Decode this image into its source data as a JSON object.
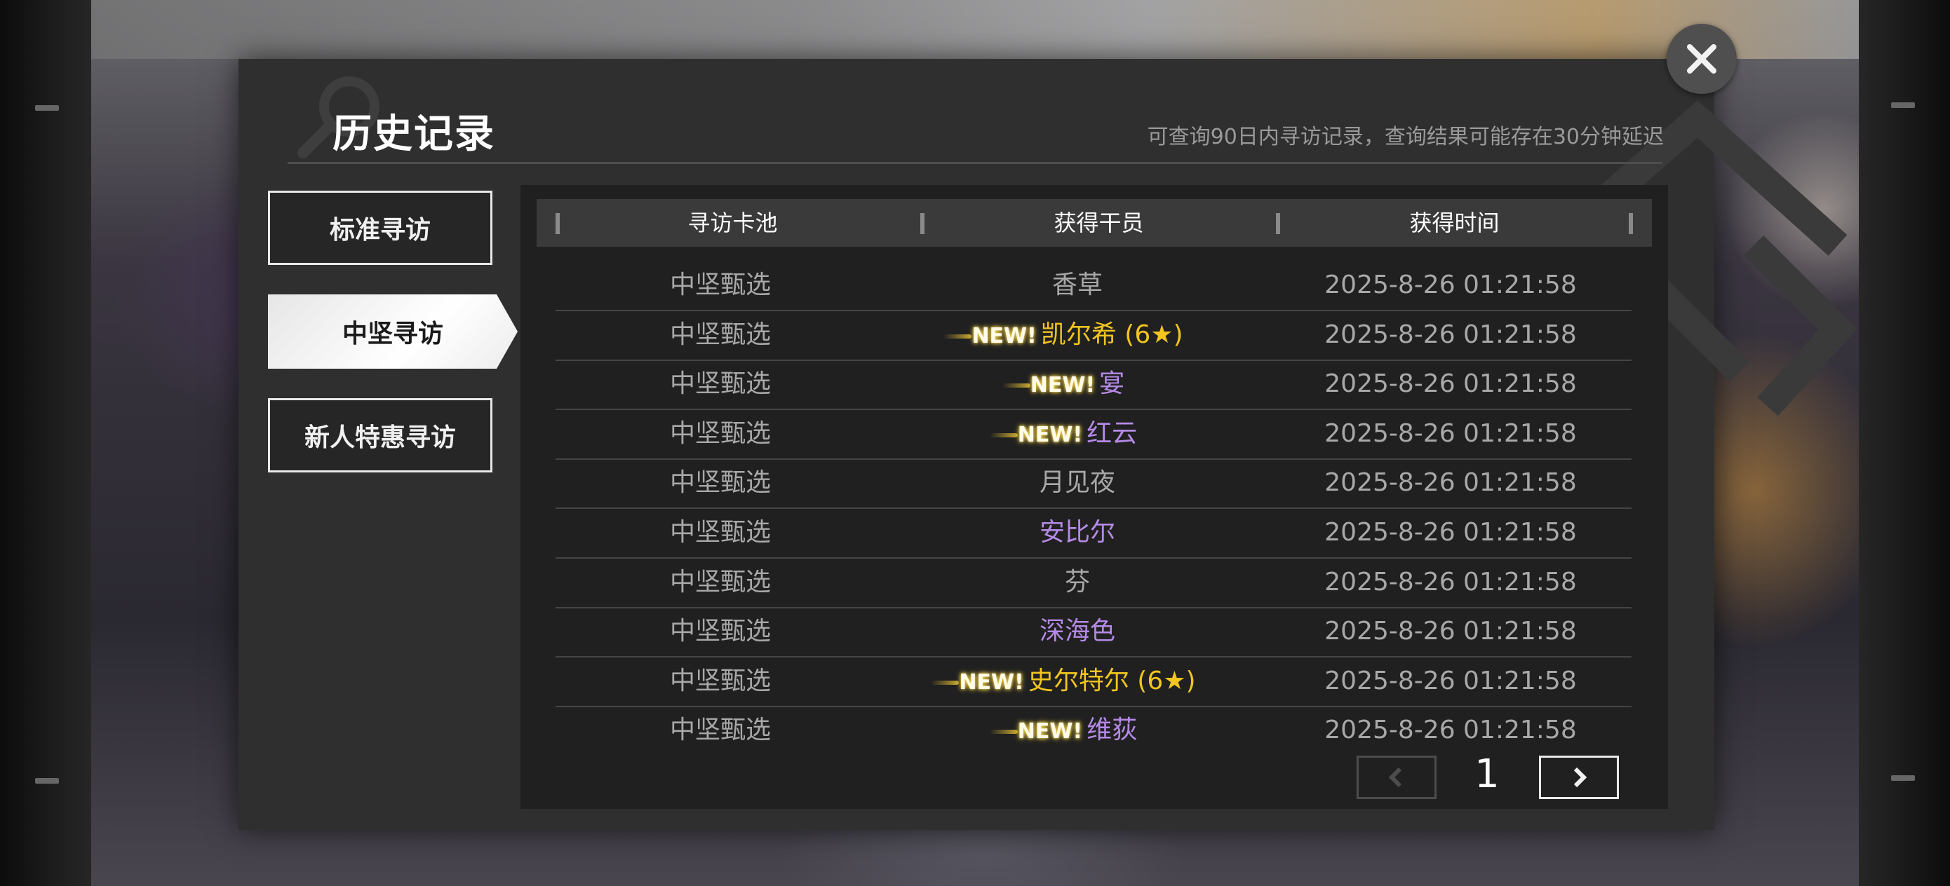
{
  "header": {
    "title": "历史记录",
    "subtitle": "可查询90日内寻访记录，查询结果可能存在30分钟延迟"
  },
  "tabs": [
    {
      "label": "标准寻访",
      "active": false
    },
    {
      "label": "中坚寻访",
      "active": true
    },
    {
      "label": "新人特惠寻访",
      "active": false
    }
  ],
  "table": {
    "columns": [
      "寻访卡池",
      "获得干员",
      "获得时间"
    ],
    "new_tag": "NEW!",
    "rows": [
      {
        "pool": "中坚甄选",
        "operator": "香草",
        "is_new": false,
        "color": "#a8a8a8",
        "time": "2025-8-26 01:21:58"
      },
      {
        "pool": "中坚甄选",
        "operator": "凯尔希 (6★)",
        "is_new": true,
        "color": "#f2c51f",
        "time": "2025-8-26 01:21:58"
      },
      {
        "pool": "中坚甄选",
        "operator": "宴",
        "is_new": true,
        "color": "#b58ae6",
        "time": "2025-8-26 01:21:58"
      },
      {
        "pool": "中坚甄选",
        "operator": "红云",
        "is_new": true,
        "color": "#b58ae6",
        "time": "2025-8-26 01:21:58"
      },
      {
        "pool": "中坚甄选",
        "operator": "月见夜",
        "is_new": false,
        "color": "#a8a8a8",
        "time": "2025-8-26 01:21:58"
      },
      {
        "pool": "中坚甄选",
        "operator": "安比尔",
        "is_new": false,
        "color": "#b58ae6",
        "time": "2025-8-26 01:21:58"
      },
      {
        "pool": "中坚甄选",
        "operator": "芬",
        "is_new": false,
        "color": "#a8a8a8",
        "time": "2025-8-26 01:21:58"
      },
      {
        "pool": "中坚甄选",
        "operator": "深海色",
        "is_new": false,
        "color": "#b58ae6",
        "time": "2025-8-26 01:21:58"
      },
      {
        "pool": "中坚甄选",
        "operator": "史尔特尔 (6★)",
        "is_new": true,
        "color": "#f2c51f",
        "time": "2025-8-26 01:21:58"
      },
      {
        "pool": "中坚甄选",
        "operator": "维荻",
        "is_new": true,
        "color": "#b58ae6",
        "time": "2025-8-26 01:21:58"
      }
    ]
  },
  "pagination": {
    "current_page": "1",
    "prev_icon": "chevron-left-icon",
    "next_icon": "chevron-right-icon"
  },
  "icons": {
    "close": "close-icon",
    "title_decoration": "search-icon"
  },
  "colors": {
    "gold": "#f2c51f",
    "purple": "#b58ae6",
    "gray": "#a8a8a8"
  }
}
